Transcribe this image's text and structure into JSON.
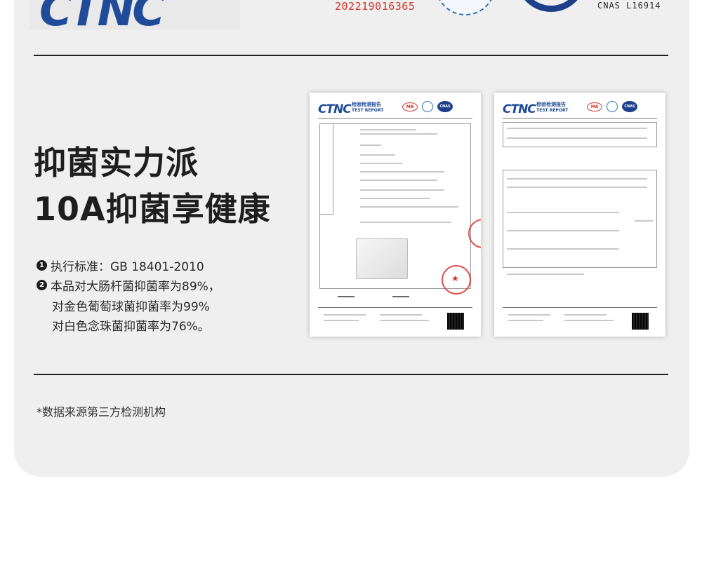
{
  "header": {
    "logo_text": "CTNC",
    "registration_number": "202219016365",
    "cnas_label": "CNAS L16914"
  },
  "headline": {
    "line1": "抑菌实力派",
    "line2": "10A抑菌享健康"
  },
  "bullets": [
    {
      "marker": "1",
      "text": "执行标准：GB 18401-2010"
    },
    {
      "marker": "2",
      "text": "本品对大肠杆菌抑菌率为89%，"
    }
  ],
  "bullet_continuation": [
    "对金色葡萄球菌抑菌率为99%",
    "对白色念珠菌抑菌率为76%。"
  ],
  "footnote": "*数据来源第三方检测机构",
  "reports": [
    {
      "logo": "CTNC",
      "title": "检验检测报告",
      "subtitle": "TEST REPORT",
      "ma": "MA",
      "cnas": "CNAS"
    },
    {
      "logo": "CTNC",
      "title": "检验检测报告",
      "subtitle": "TEST REPORT",
      "ma": "MA",
      "cnas": "CNAS"
    }
  ],
  "colors": {
    "brand_blue": "#1f4b99",
    "stamp_red": "#d6312b",
    "background_card": "#efefef"
  }
}
